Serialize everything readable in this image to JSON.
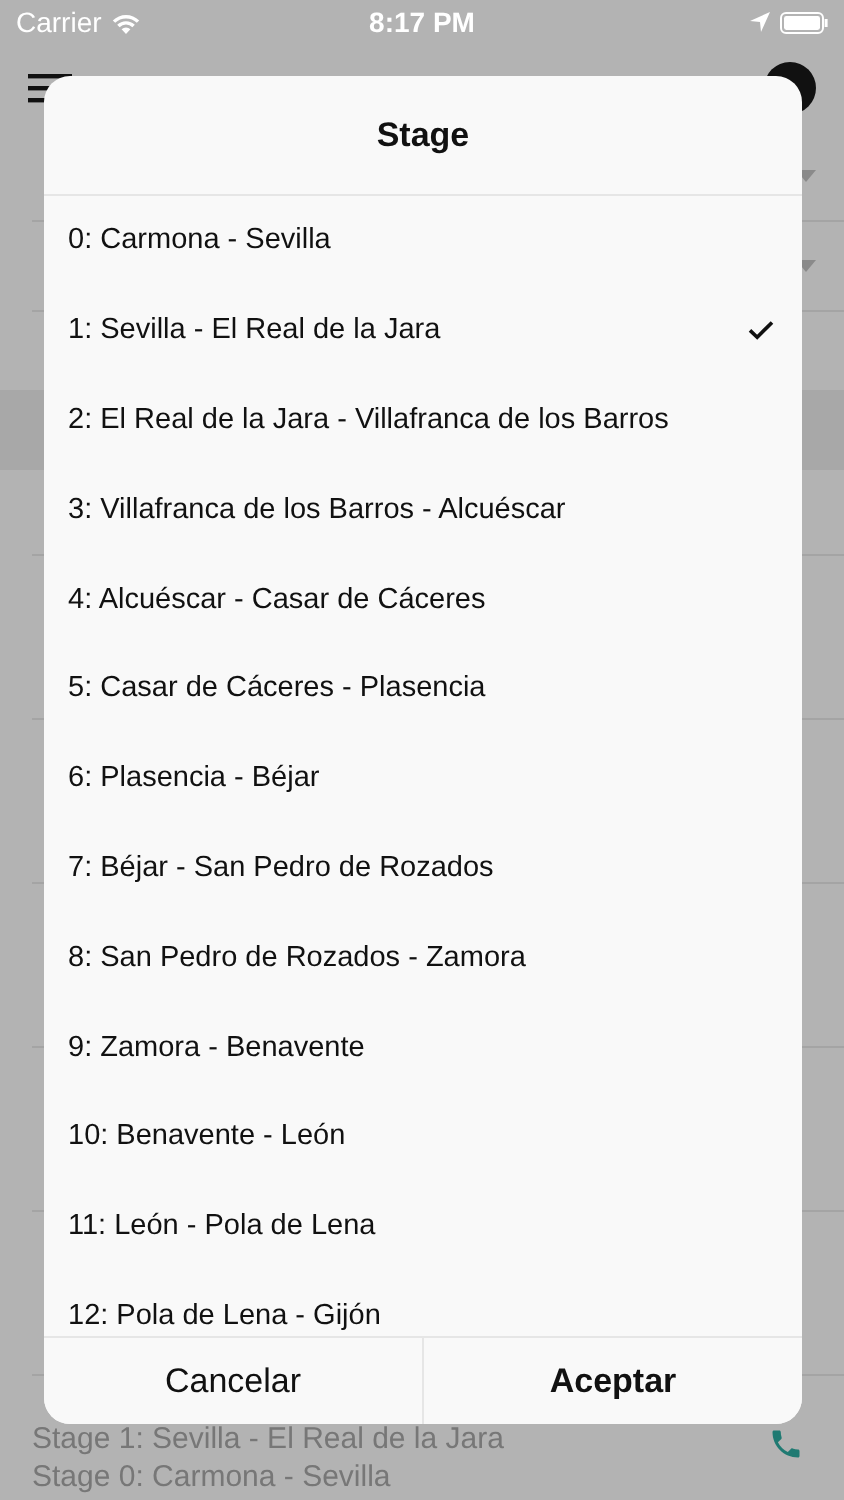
{
  "status_bar": {
    "carrier": "Carrier",
    "time": "8:17 PM"
  },
  "background_row": {
    "lines": [
      "Stage 1: Sevilla - El Real de la Jara",
      "Stage 0: Carmona - Sevilla"
    ]
  },
  "dialog": {
    "title": "Stage",
    "options": [
      {
        "label": "0: Carmona - Sevilla",
        "selected": false
      },
      {
        "label": "1: Sevilla - El Real de la Jara",
        "selected": true
      },
      {
        "label": "2: El Real de la Jara - Villafranca de los Barros",
        "selected": false
      },
      {
        "label": "3: Villafranca de los Barros - Alcuéscar",
        "selected": false
      },
      {
        "label": "4: Alcuéscar - Casar de Cáceres",
        "selected": false
      },
      {
        "label": "5: Casar de Cáceres - Plasencia",
        "selected": false
      },
      {
        "label": "6: Plasencia - Béjar",
        "selected": false
      },
      {
        "label": "7: Béjar - San Pedro de Rozados",
        "selected": false
      },
      {
        "label": "8: San Pedro de Rozados - Zamora",
        "selected": false
      },
      {
        "label": "9: Zamora - Benavente",
        "selected": false
      },
      {
        "label": "10: Benavente - León",
        "selected": false
      },
      {
        "label": "11: León - Pola de Lena",
        "selected": false
      },
      {
        "label": "12: Pola de Lena - Gijón",
        "selected": false
      }
    ],
    "buttons": [
      {
        "label": "Cancelar",
        "kind": "cancel"
      },
      {
        "label": "Aceptar",
        "kind": "confirm"
      }
    ]
  }
}
